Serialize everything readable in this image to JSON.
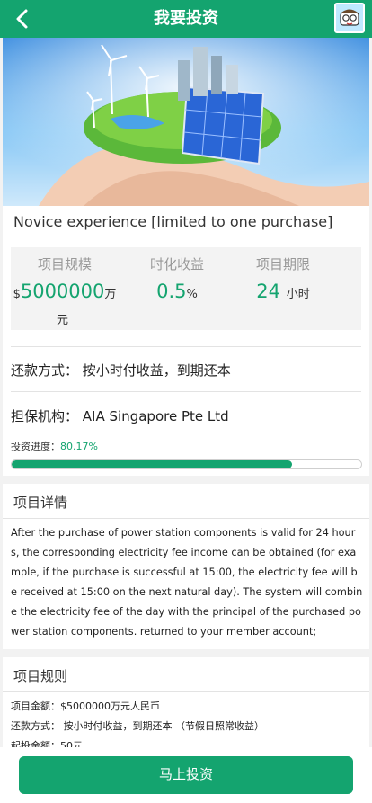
{
  "header": {
    "title": "我要投资",
    "back_icon": "chevron-left-icon",
    "avatar_icon": "cartoon-avatar-icon"
  },
  "hero": {
    "image": "hands-holding-green-energy-globe"
  },
  "product": {
    "name": "Novice experience [limited to one purchase]",
    "stats": [
      {
        "label": "项目规模",
        "prefix": "$",
        "value": "5000000",
        "unit": "万",
        "unit2": "元"
      },
      {
        "label": "时化收益",
        "value": "0.5",
        "unit": "%"
      },
      {
        "label": "项目期限",
        "value": "24",
        "unit": "小时"
      }
    ],
    "repayment_label": "还款方式：",
    "repayment_value": "按小时付收益，到期还本",
    "guarantee_label": "担保机构：",
    "guarantee_value": "AIA Singapore Pte Ltd",
    "progress_label": "投资进度：",
    "progress_value": "80.17%",
    "progress_fraction": 0.8017
  },
  "details": {
    "title": "项目详情",
    "text": "After the purchase of power station components is valid for 24 hours, the corresponding electricity fee income can be obtained (for example, if the purchase is successful at 15:00, the electricity fee will be received at 15:00 on the next natural day). The system will combine the electricity fee of the day with the principal of the purchased power station components. returned to your member account;"
  },
  "rules": {
    "title": "项目规则",
    "items": [
      "项目金额：$5000000万元人民币",
      "还款方式： 按小时付收益，到期还本 （节假日照常收益）",
      "起投金额：50元"
    ]
  },
  "footer": {
    "button_label": "马上投资"
  },
  "colors": {
    "primary": "#14a46f",
    "background": "#f2f2f2"
  }
}
